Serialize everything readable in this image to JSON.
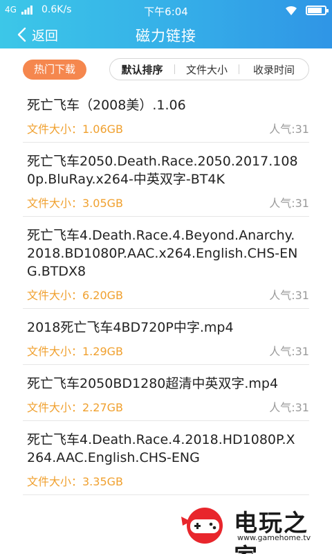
{
  "status_bar": {
    "network": "4G",
    "speed": "0.6K/s",
    "time": "下午6:04",
    "battery_level": 0.85
  },
  "nav": {
    "back_label": "返回",
    "title": "磁力链接"
  },
  "filters": {
    "hot_download": "热门下载",
    "sort_options": [
      "默认排序",
      "文件大小",
      "收录时间"
    ],
    "active_sort": "默认排序"
  },
  "items": [
    {
      "title": "死亡飞车（2008美）.1.06",
      "size": "文件大小：1.06GB",
      "popularity": "人气:31"
    },
    {
      "title": "死亡飞车2050.Death.Race.2050.2017.1080p.BluRay.x264-中英双字-BT4K",
      "size": "文件大小：3.05GB",
      "popularity": "人气:31"
    },
    {
      "title": "死亡飞车4.Death.Race.4.Beyond.Anarchy.2018.BD1080P.AAC.x264.English.CHS-ENG.BTDX8",
      "size": "文件大小：6.20GB",
      "popularity": "人气:31"
    },
    {
      "title": "2018死亡飞车4BD720P中字.mp4",
      "size": "文件大小：1.29GB",
      "popularity": "人气:31"
    },
    {
      "title": "死亡飞车2050BD1280超清中英双字.mp4",
      "size": "文件大小：2.27GB",
      "popularity": "人气:31"
    },
    {
      "title": "死亡飞车4.Death.Race.4.2018.HD1080P.X264.AAC.English.CHS-ENG",
      "size": "文件大小：3.35GB",
      "popularity": ""
    }
  ],
  "watermark": {
    "name": "电玩之家",
    "url": "www.gamehome.tv"
  },
  "colors": {
    "header_start": "#3cc7e8",
    "header_end": "#2f95e6",
    "accent_orange": "#f5874e",
    "size_text": "#f0a02e"
  }
}
